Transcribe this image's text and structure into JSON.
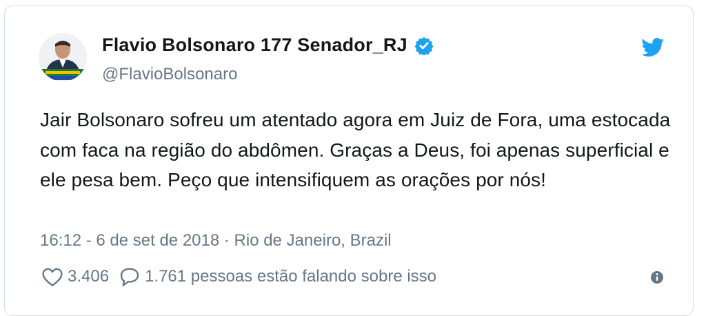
{
  "tweet": {
    "display_name": "Flavio Bolsonaro 177 Senador_RJ",
    "handle": "@FlavioBolsonaro",
    "verified": true,
    "text": "Jair Bolsonaro sofreu um atentado agora em Juiz de Fora, uma estocada com faca na região do abdômen. Graças a Deus, foi apenas superficial e ele pesa bem. Peço que intensifiquem as orações por nós!",
    "timestamp": "16:12 - 6 de set de 2018 · Rio de Janeiro, Brazil",
    "likes": "3.406",
    "conversation": "1.761 pessoas estão falando sobre isso"
  },
  "icons": {
    "verified": "verified-badge-icon",
    "brand": "twitter-bird-icon",
    "like": "heart-icon",
    "reply": "speech-bubble-icon",
    "info": "info-icon"
  },
  "colors": {
    "brand": "#1da1f2",
    "text": "#14171a",
    "secondary": "#657786",
    "border": "#d8dde2"
  }
}
